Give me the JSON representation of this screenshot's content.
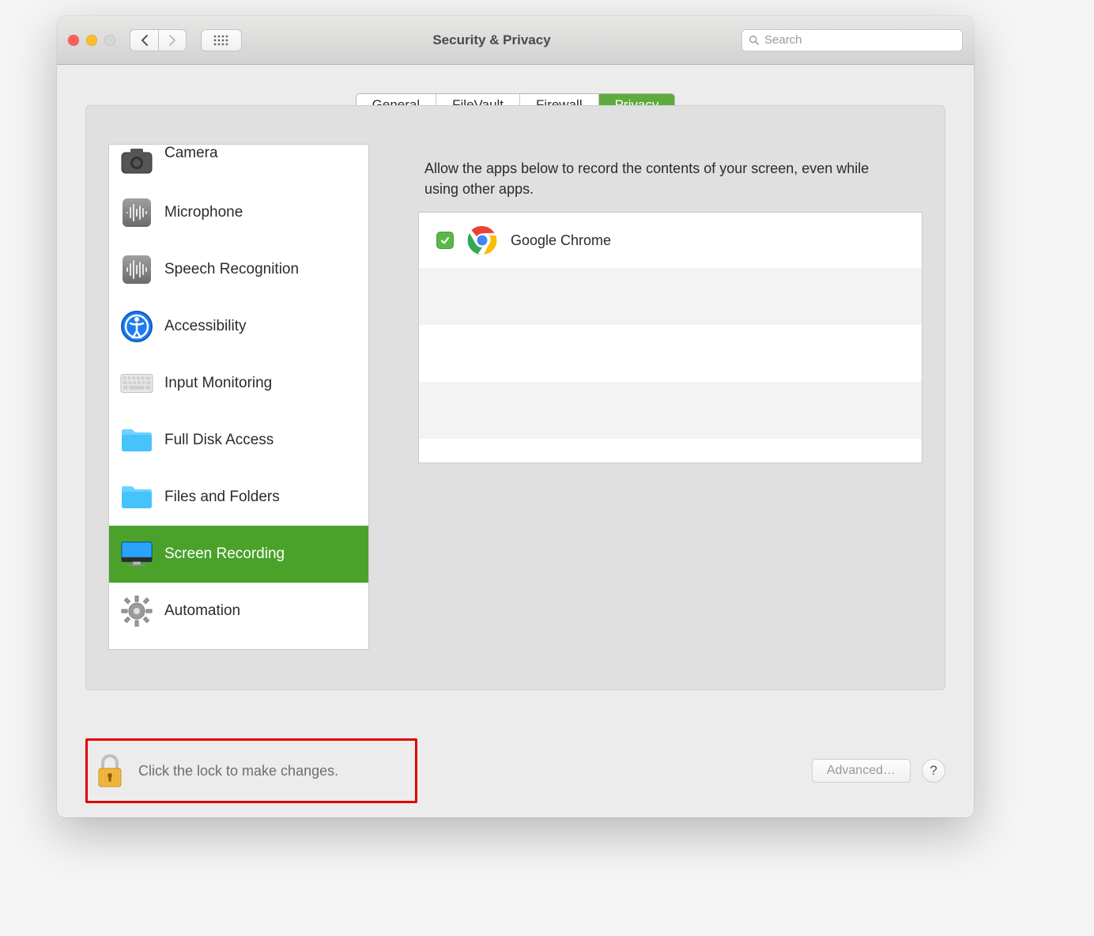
{
  "window": {
    "title": "Security & Privacy"
  },
  "search": {
    "placeholder": "Search"
  },
  "tabs": {
    "items": [
      "General",
      "FileVault",
      "Firewall",
      "Privacy"
    ],
    "selected": "Privacy"
  },
  "categories": {
    "selected": "Screen Recording",
    "items": [
      {
        "label": "Camera",
        "icon": "camera"
      },
      {
        "label": "Microphone",
        "icon": "microphone"
      },
      {
        "label": "Speech Recognition",
        "icon": "waveform"
      },
      {
        "label": "Accessibility",
        "icon": "accessibility"
      },
      {
        "label": "Input Monitoring",
        "icon": "keyboard"
      },
      {
        "label": "Full Disk Access",
        "icon": "folder"
      },
      {
        "label": "Files and Folders",
        "icon": "folder"
      },
      {
        "label": "Screen Recording",
        "icon": "display"
      },
      {
        "label": "Automation",
        "icon": "gear"
      }
    ]
  },
  "detail": {
    "description": "Allow the apps below to record the contents of your screen, even while using other apps.",
    "apps": [
      {
        "name": "Google Chrome",
        "checked": true,
        "icon": "chrome"
      }
    ]
  },
  "footer": {
    "lock_text": "Click the lock to make changes.",
    "advanced_label": "Advanced…"
  }
}
